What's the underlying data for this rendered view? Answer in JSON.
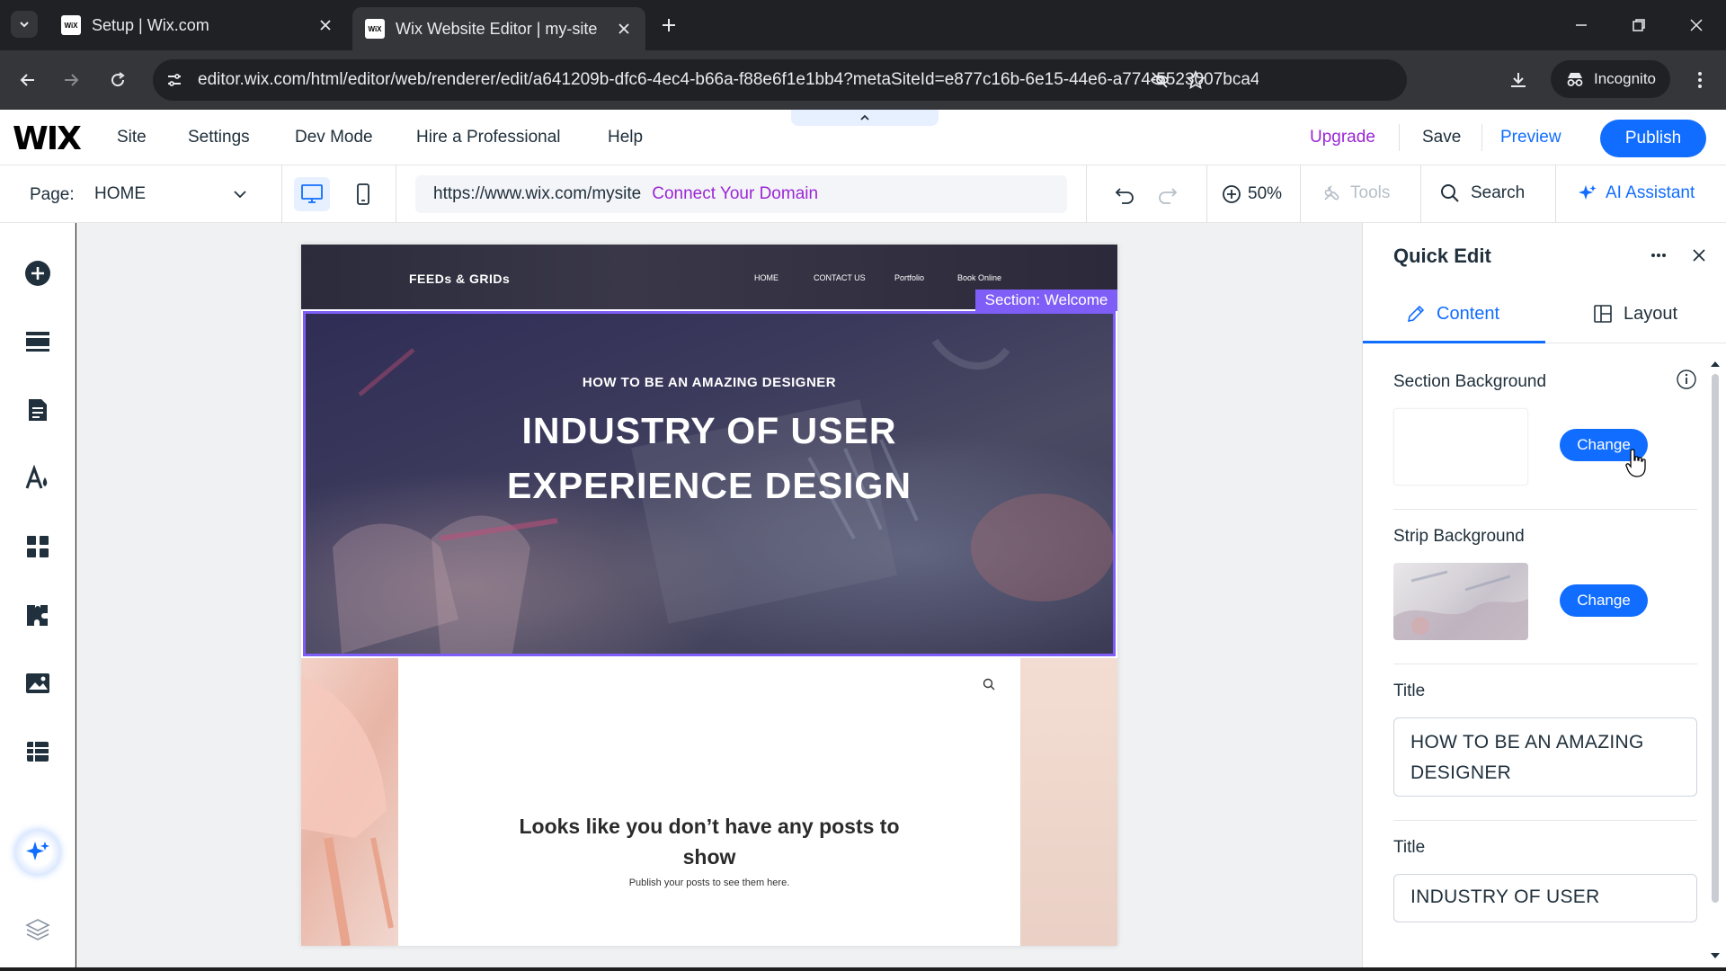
{
  "browser": {
    "tabs": [
      {
        "title": "Setup | Wix.com",
        "favicon": "WiX",
        "active": false
      },
      {
        "title": "Wix Website Editor | my-site",
        "favicon": "WiX",
        "active": true
      }
    ],
    "url": "editor.wix.com/html/editor/web/renderer/edit/a641209b-dfc6-4ec4-b66a-f88e6f1e1bb4?metaSiteId=e877c16b-6e15-44e6-a774-5523007bca4c&edito...",
    "incognito_label": "Incognito"
  },
  "wix_top": {
    "logo": "WIX",
    "menu": [
      "Site",
      "Settings",
      "Dev Mode",
      "Hire a Professional",
      "Help"
    ],
    "upgrade": "Upgrade",
    "save": "Save",
    "preview": "Preview",
    "publish": "Publish"
  },
  "wix_sub": {
    "page_label": "Page:",
    "page_value": "HOME",
    "site_url": "https://www.wix.com/mysite",
    "connect_domain": "Connect Your Domain",
    "zoom": "50%",
    "tools": "Tools",
    "search": "Search",
    "ai_assistant": "AI Assistant"
  },
  "site": {
    "brand": "FEEDs & GRIDs",
    "nav": [
      "HOME",
      "CONTACT US",
      "Portfolio",
      "Book Online"
    ],
    "section_tag": "Section: Welcome",
    "hero_eyebrow": "HOW TO BE AN AMAZING DESIGNER",
    "hero_title_line1": "INDUSTRY OF USER",
    "hero_title_line2": "EXPERIENCE DESIGN",
    "blog_empty_title_line1": "Looks like you don’t have any posts to",
    "blog_empty_title_line2": "show",
    "blog_empty_sub": "Publish your posts to see them here."
  },
  "panel": {
    "title": "Quick Edit",
    "tabs": [
      "Content",
      "Layout"
    ],
    "section_bg_label": "Section Background",
    "strip_bg_label": "Strip Background",
    "change_label": "Change",
    "title_label": "Title",
    "title1_value_line1": "HOW TO BE AN AMAZING",
    "title1_value_line2": "DESIGNER",
    "title2_value": "INDUSTRY OF USER"
  },
  "colors": {
    "accent_blue": "#116dff",
    "upgrade_purple": "#9a27d5",
    "selection_purple": "#7f5df7"
  }
}
